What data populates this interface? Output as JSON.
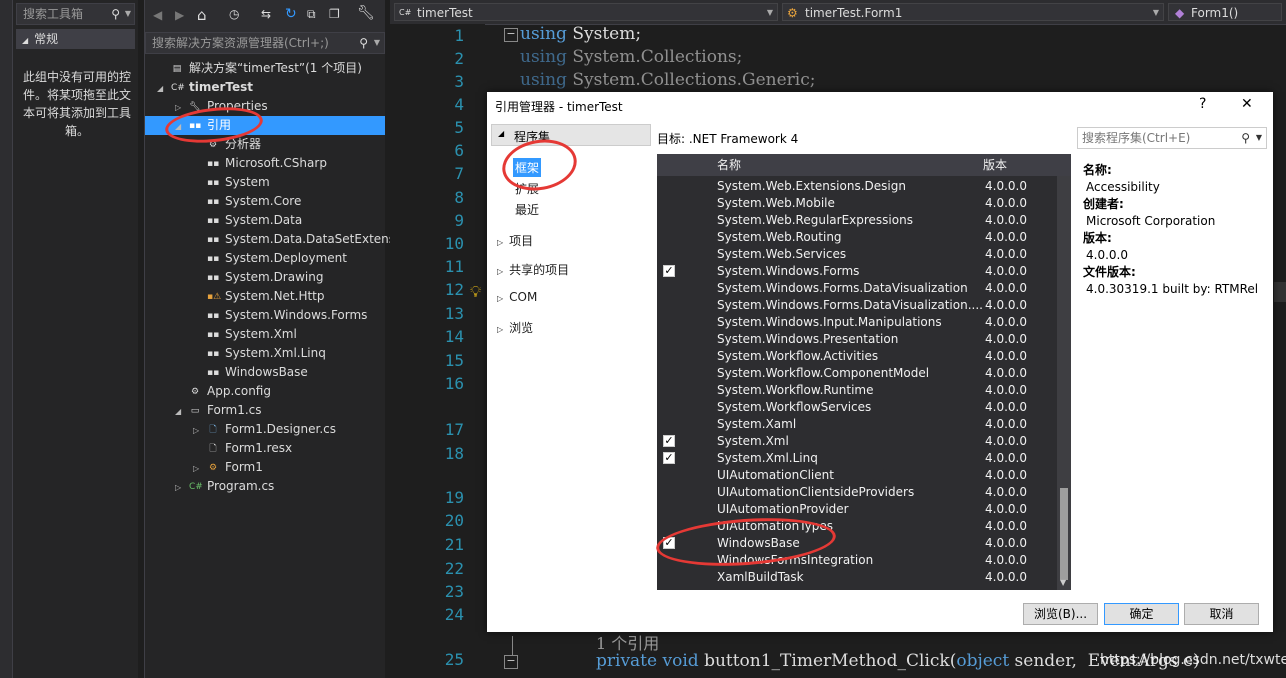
{
  "toolbox": {
    "search_placeholder": "搜索工具箱",
    "group_label": "常规",
    "empty_text": "此组中没有可用的控件。将某项拖至此文本可将其添加到工具箱。"
  },
  "solution_explorer": {
    "search_placeholder": "搜索解决方案资源管理器(Ctrl+;)",
    "items": [
      {
        "label": "解决方案“timerTest”(1 个项目)"
      },
      {
        "label": "timerTest"
      },
      {
        "label": "Properties"
      },
      {
        "label": "引用"
      },
      {
        "label": "分析器"
      },
      {
        "label": "Microsoft.CSharp"
      },
      {
        "label": "System"
      },
      {
        "label": "System.Core"
      },
      {
        "label": "System.Data"
      },
      {
        "label": "System.Data.DataSetExtens"
      },
      {
        "label": "System.Deployment"
      },
      {
        "label": "System.Drawing"
      },
      {
        "label": "System.Net.Http"
      },
      {
        "label": "System.Windows.Forms"
      },
      {
        "label": "System.Xml"
      },
      {
        "label": "System.Xml.Linq"
      },
      {
        "label": "WindowsBase"
      },
      {
        "label": "App.config"
      },
      {
        "label": "Form1.cs"
      },
      {
        "label": "Form1.Designer.cs"
      },
      {
        "label": "Form1.resx"
      },
      {
        "label": "Form1"
      },
      {
        "label": "Program.cs"
      }
    ]
  },
  "editor": {
    "combo_project": "timerTest",
    "combo_class": "timerTest.Form1",
    "combo_member": "Form1()",
    "line_numbers": [
      "1",
      "2",
      "3",
      "4",
      "5",
      "6",
      "7",
      "8",
      "9",
      "10",
      "11",
      "12",
      "13",
      "14",
      "15",
      "16",
      "17",
      "18",
      "19",
      "20",
      "21",
      "22",
      "23",
      "24",
      "25"
    ],
    "code_lines": [
      {
        "kw": "using",
        "rest": " System;"
      },
      {
        "kw": "using",
        "rest": " System.Collections;"
      },
      {
        "kw": "using",
        "rest": " System.Collections.Generic;"
      }
    ],
    "refs_hint": "1 个引用",
    "line25": {
      "kw1": "private",
      "kw2": "void",
      "name": "button1_TimerMethod_Click(",
      "kw3": "object",
      "tail": " sender,  EventArgs e)"
    },
    "watermark": "https://blog.csdn.net/txwtech"
  },
  "dialog": {
    "title": "引用管理器 - timerTest",
    "help": "?",
    "close": "✕",
    "nav": {
      "assemblies": "程序集",
      "framework": "框架",
      "extensions": "扩展",
      "recent": "最近",
      "projects": "项目",
      "shared": "共享的项目",
      "com": "COM",
      "browse": "浏览"
    },
    "target": "目标: .NET Framework 4",
    "search_placeholder": "搜索程序集(Ctrl+E)",
    "col_name": "名称",
    "col_version": "版本",
    "rows": [
      {
        "name": "System.Web.Extensions.Design",
        "version": "4.0.0.0",
        "checked": false
      },
      {
        "name": "System.Web.Mobile",
        "version": "4.0.0.0",
        "checked": false
      },
      {
        "name": "System.Web.RegularExpressions",
        "version": "4.0.0.0",
        "checked": false
      },
      {
        "name": "System.Web.Routing",
        "version": "4.0.0.0",
        "checked": false
      },
      {
        "name": "System.Web.Services",
        "version": "4.0.0.0",
        "checked": false
      },
      {
        "name": "System.Windows.Forms",
        "version": "4.0.0.0",
        "checked": true
      },
      {
        "name": "System.Windows.Forms.DataVisualization",
        "version": "4.0.0.0",
        "checked": false
      },
      {
        "name": "System.Windows.Forms.DataVisualization....",
        "version": "4.0.0.0",
        "checked": false
      },
      {
        "name": "System.Windows.Input.Manipulations",
        "version": "4.0.0.0",
        "checked": false
      },
      {
        "name": "System.Windows.Presentation",
        "version": "4.0.0.0",
        "checked": false
      },
      {
        "name": "System.Workflow.Activities",
        "version": "4.0.0.0",
        "checked": false
      },
      {
        "name": "System.Workflow.ComponentModel",
        "version": "4.0.0.0",
        "checked": false
      },
      {
        "name": "System.Workflow.Runtime",
        "version": "4.0.0.0",
        "checked": false
      },
      {
        "name": "System.WorkflowServices",
        "version": "4.0.0.0",
        "checked": false
      },
      {
        "name": "System.Xaml",
        "version": "4.0.0.0",
        "checked": false
      },
      {
        "name": "System.Xml",
        "version": "4.0.0.0",
        "checked": true
      },
      {
        "name": "System.Xml.Linq",
        "version": "4.0.0.0",
        "checked": true
      },
      {
        "name": "UIAutomationClient",
        "version": "4.0.0.0",
        "checked": false
      },
      {
        "name": "UIAutomationClientsideProviders",
        "version": "4.0.0.0",
        "checked": false
      },
      {
        "name": "UIAutomationProvider",
        "version": "4.0.0.0",
        "checked": false
      },
      {
        "name": "UIAutomationTypes",
        "version": "4.0.0.0",
        "checked": false
      },
      {
        "name": "WindowsBase",
        "version": "4.0.0.0",
        "checked": true
      },
      {
        "name": "WindowsFormsIntegration",
        "version": "4.0.0.0",
        "checked": false
      },
      {
        "name": "XamlBuildTask",
        "version": "4.0.0.0",
        "checked": false
      }
    ],
    "details": {
      "name_label": "名称:",
      "name_value": "Accessibility",
      "creator_label": "创建者:",
      "creator_value": "Microsoft Corporation",
      "version_label": "版本:",
      "version_value": "4.0.0.0",
      "file_version_label": "文件版本:",
      "file_version_value": "4.0.30319.1 built by: RTMRel"
    },
    "buttons": {
      "browse": "浏览(B)...",
      "ok": "确定",
      "cancel": "取消"
    }
  },
  "colors": {
    "accent": "#3399ff",
    "annotation": "#e53935",
    "keyword": "#569cd6",
    "linenum": "#2b91af"
  }
}
